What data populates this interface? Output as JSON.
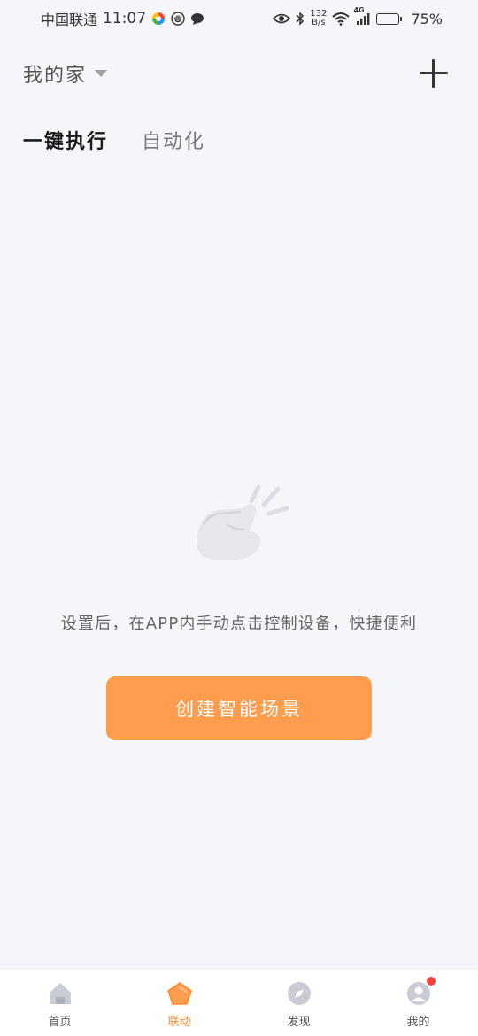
{
  "status_bar": {
    "carrier": "中国联通",
    "time": "11:07",
    "net_speed_value": "132",
    "net_speed_unit": "B/s",
    "network_type": "4G",
    "battery_percent": "75%",
    "battery_level": 0.75,
    "left_icons": [
      "colorful-app-icon",
      "hand-icon",
      "chat-bubble-icon"
    ],
    "right_icons": [
      "eye-icon",
      "bluetooth-icon",
      "wifi-icon",
      "signal-icon",
      "battery-icon"
    ]
  },
  "header": {
    "home_name": "我的家",
    "dropdown_icon": "caret-down-icon",
    "add_icon": "plus-icon"
  },
  "tabs": [
    {
      "label": "一键执行",
      "active": true
    },
    {
      "label": "自动化",
      "active": false
    }
  ],
  "empty_state": {
    "illustration": "tap-hand-icon",
    "message": "设置后，在APP内手动点击控制设备，快捷便利",
    "create_button": "创建智能场景"
  },
  "colors": {
    "accent": "#ff9d4f",
    "active_nav": "#ff8a2b",
    "badge": "#f4433c",
    "background": "#f5f6fa"
  },
  "bottom_nav": [
    {
      "label": "首页",
      "icon": "home-icon",
      "active": false
    },
    {
      "label": "联动",
      "icon": "pentagon-icon",
      "active": true
    },
    {
      "label": "发现",
      "icon": "compass-icon",
      "active": false
    },
    {
      "label": "我的",
      "icon": "profile-icon",
      "active": false,
      "badge": true
    }
  ]
}
